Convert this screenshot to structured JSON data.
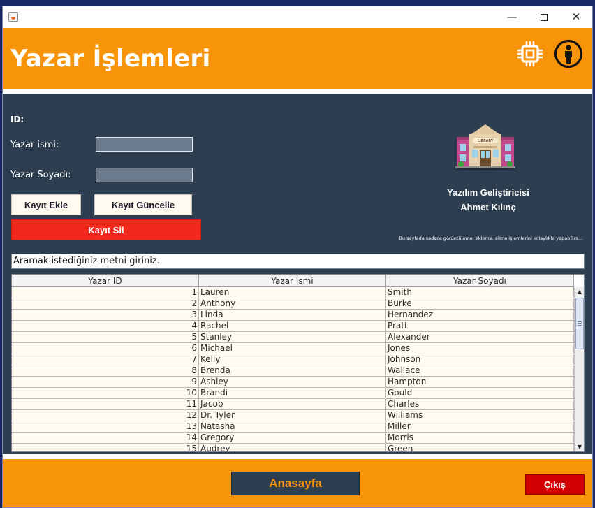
{
  "window": {
    "controls": {
      "minimize": "—",
      "close": "✕"
    }
  },
  "header": {
    "title": "Yazar İşlemleri",
    "icons": [
      "cpu-icon",
      "person-info-icon"
    ],
    "color": "#f7940a"
  },
  "form": {
    "id_label": "ID:",
    "name_label": "Yazar ismi:",
    "surname_label": "Yazar Soyadı:",
    "name_value": "",
    "surname_value": ""
  },
  "buttons": {
    "add": "Kayıt Ekle",
    "update": "Kayıt Güncelle",
    "delete": "Kayıt Sil",
    "home": "Anasayfa",
    "exit": "Çıkış"
  },
  "info": {
    "logo_icon": "library-building-icon",
    "logo_text": "LIBRARY",
    "developer_line1": "Yazılım Geliştiricisi",
    "developer_line2": "Ahmet Kılınç",
    "note": "Bu sayfada sadece görüntüleme, ekleme, silme işlemlerini kolaylıkla yapabilirs..."
  },
  "search": {
    "text": "Aramak istediğiniz metni giriniz."
  },
  "table": {
    "columns": [
      "Yazar ID",
      "Yazar İsmi",
      "Yazar Soyadı"
    ],
    "rows": [
      [
        "1",
        "Lauren",
        "Smith"
      ],
      [
        "2",
        "Anthony",
        "Burke"
      ],
      [
        "3",
        "Linda",
        "Hernandez"
      ],
      [
        "4",
        "Rachel",
        "Pratt"
      ],
      [
        "5",
        "Stanley",
        "Alexander"
      ],
      [
        "6",
        "Michael",
        "Jones"
      ],
      [
        "7",
        "Kelly",
        "Johnson"
      ],
      [
        "8",
        "Brenda",
        "Wallace"
      ],
      [
        "9",
        "Ashley",
        "Hampton"
      ],
      [
        "10",
        "Brandi",
        "Gould"
      ],
      [
        "11",
        "Jacob",
        "Charles"
      ],
      [
        "12",
        "Dr. Tyler",
        "Williams"
      ],
      [
        "13",
        "Natasha",
        "Miller"
      ],
      [
        "14",
        "Gregory",
        "Morris"
      ],
      [
        "15",
        "Audrey",
        "Green"
      ]
    ]
  },
  "colors": {
    "panel": "#2d3e50",
    "accent": "#f7940a",
    "delete": "#f1281b",
    "exit": "#d10000"
  }
}
